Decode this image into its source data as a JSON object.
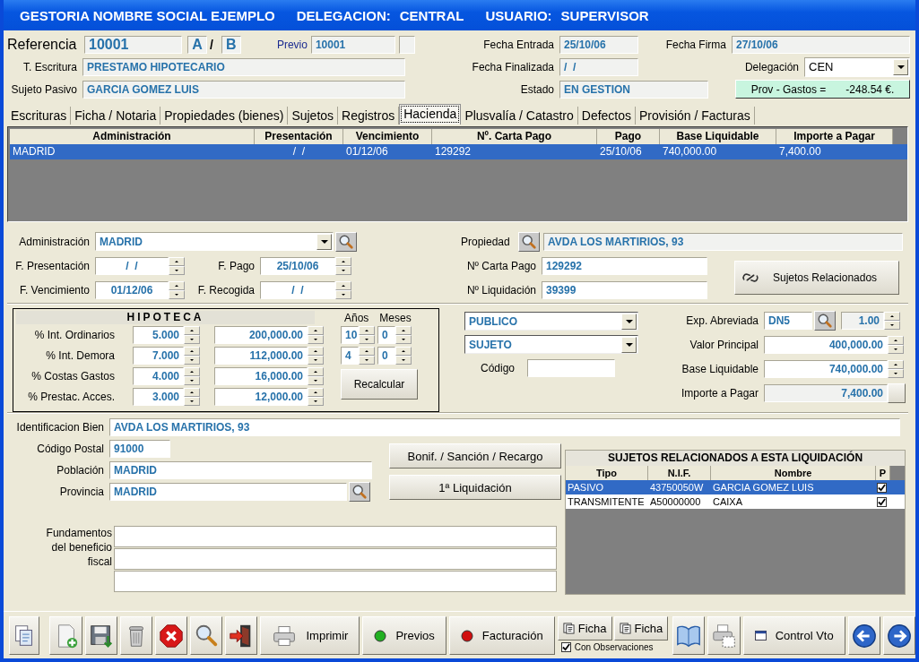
{
  "window": {
    "title_parts": [
      "GESTORIA NOMBRE SOCIAL EJEMPLO",
      "DELEGACION:",
      "CENTRAL",
      "USUARIO:",
      "SUPERVISOR"
    ]
  },
  "header": {
    "referencia": {
      "label": "Referencia",
      "value": "10001"
    },
    "serie_a": "A",
    "serie_sep": "/",
    "serie_b": "B",
    "previo": {
      "label": "Previo",
      "value": "10001"
    },
    "t_escritura": {
      "label": "T. Escritura",
      "value": "PRESTAMO HIPOTECARIO"
    },
    "sujeto_pasivo": {
      "label": "Sujeto Pasivo",
      "value": "GARCIA GOMEZ LUIS"
    },
    "fecha_entrada": {
      "label": "Fecha Entrada",
      "value": "25/10/06"
    },
    "fecha_finalizada": {
      "label": "Fecha Finalizada",
      "value": "/  /"
    },
    "estado": {
      "label": "Estado",
      "value": "EN GESTION"
    },
    "fecha_firma": {
      "label": "Fecha Firma",
      "value": "27/10/06"
    },
    "delegacion": {
      "label": "Delegación",
      "value": "CEN"
    },
    "prov_gastos": {
      "label": "Prov - Gastos =",
      "value": "-248.54 €."
    }
  },
  "tabs": [
    {
      "label": "Escrituras",
      "selected": false
    },
    {
      "label": "Ficha / Notaria",
      "selected": false
    },
    {
      "label": "Propiedades (bienes)",
      "selected": false
    },
    {
      "label": "Sujetos",
      "selected": false
    },
    {
      "label": "Registros",
      "selected": false
    },
    {
      "label": "Hacienda",
      "selected": true
    },
    {
      "label": "Plusvalía / Catastro",
      "selected": false
    },
    {
      "label": "Defectos",
      "selected": false
    },
    {
      "label": "Provisión / Facturas",
      "selected": false
    }
  ],
  "liquidaciones": {
    "columns": [
      "Administración",
      "Presentación",
      "Vencimiento",
      "Nº. Carta Pago",
      "Pago",
      "Base Liquidable",
      "Importe a Pagar"
    ],
    "rows": [
      {
        "selected": true,
        "cells": [
          "MADRID",
          "/  /",
          "01/12/06",
          "129292",
          "25/10/06",
          "740,000.00",
          "7,400.00"
        ]
      }
    ]
  },
  "form": {
    "administracion": {
      "label": "Administración",
      "value": "MADRID"
    },
    "f_presentacion": {
      "label": "F. Presentación",
      "value": "/  /"
    },
    "f_pago": {
      "label": "F. Pago",
      "value": "25/10/06"
    },
    "f_vencimiento": {
      "label": "F. Vencimiento",
      "value": "01/12/06"
    },
    "f_recogida": {
      "label": "F. Recogida",
      "value": "/  /"
    },
    "propiedad": {
      "label": "Propiedad",
      "value": "AVDA LOS MARTIRIOS, 93"
    },
    "carta_pago": {
      "label": "Nº Carta Pago",
      "value": "129292"
    },
    "liquidacion": {
      "label": "Nº Liquidación",
      "value": "39399"
    },
    "sujetos_button": "Sujetos Relacionados"
  },
  "hipoteca": {
    "title": "HIPOTECA",
    "rows": [
      {
        "label": "% Int. Ordinarios",
        "percent": "5.000",
        "amount": "200,000.00"
      },
      {
        "label": "% Int. Demora",
        "percent": "7.000",
        "amount": "112,000.00"
      },
      {
        "label": "% Costas Gastos",
        "percent": "4.000",
        "amount": "16,000.00"
      },
      {
        "label": "% Prestac. Acces.",
        "percent": "3.000",
        "amount": "12,000.00"
      }
    ],
    "plazo_headers": [
      "Años",
      "Meses"
    ],
    "plazos": [
      [
        "10",
        "0"
      ],
      [
        "4",
        "0"
      ]
    ],
    "recalcular": "Recalcular"
  },
  "calculo": {
    "tipo": "PUBLICO",
    "sujeto": "SUJETO",
    "codigo_label": "Código",
    "exp_abreviada": {
      "label": "Exp. Abreviada",
      "value": "DN5",
      "factor": "1.00"
    },
    "valor_principal": {
      "label": "Valor Principal",
      "value": "400,000.00"
    },
    "base_liquidable": {
      "label": "Base Liquidable",
      "value": "740,000.00"
    },
    "importe": {
      "label": "Importe a Pagar",
      "value": "7,400.00"
    }
  },
  "bien": {
    "identificacion": {
      "label": "Identificacion Bien",
      "value": "AVDA LOS MARTIRIOS, 93"
    },
    "codigo_postal": {
      "label": "Código Postal",
      "value": "91000"
    },
    "poblacion": {
      "label": "Población",
      "value": "MADRID"
    },
    "provincia": {
      "label": "Provincia",
      "value": "MADRID"
    },
    "fundamentos_label": "Fundamentos del beneficio fiscal"
  },
  "actions": [
    "Bonif. / Sanción / Recargo",
    "1ª Liquidación"
  ],
  "sujetos": {
    "title": "SUJETOS RELACIONADOS A ESTA LIQUIDACIÓN",
    "columns": [
      "Tipo",
      "N.I.F.",
      "Nombre",
      "P"
    ],
    "rows": [
      {
        "selected": true,
        "checked": true,
        "cells": [
          "PASIVO",
          "43750050W",
          "GARCIA GOMEZ LUIS"
        ]
      },
      {
        "selected": false,
        "checked": true,
        "cells": [
          "TRANSMITENTE",
          "A50000000",
          "CAIXA"
        ]
      }
    ]
  },
  "toolbar": [
    {
      "kind": "icon"
    },
    {
      "kind": "icon"
    },
    {
      "kind": "icon"
    },
    {
      "kind": "icon"
    },
    {
      "kind": "icon"
    },
    {
      "kind": "icon"
    },
    {
      "kind": "icon"
    },
    {
      "kind": "button",
      "label": "Imprimir"
    },
    {
      "kind": "button",
      "label": "Previos",
      "color": "#22b022"
    },
    {
      "kind": "button",
      "label": "Facturación",
      "color": "#d01010"
    },
    {
      "kind": "ficha",
      "labels": [
        "Ficha",
        "Ficha"
      ],
      "option": {
        "label": "Con Observaciones",
        "checked": true
      }
    },
    {
      "kind": "icon"
    },
    {
      "kind": "icon"
    },
    {
      "kind": "button",
      "label": "Control Vto"
    },
    {
      "kind": "icon"
    },
    {
      "kind": "icon"
    }
  ]
}
